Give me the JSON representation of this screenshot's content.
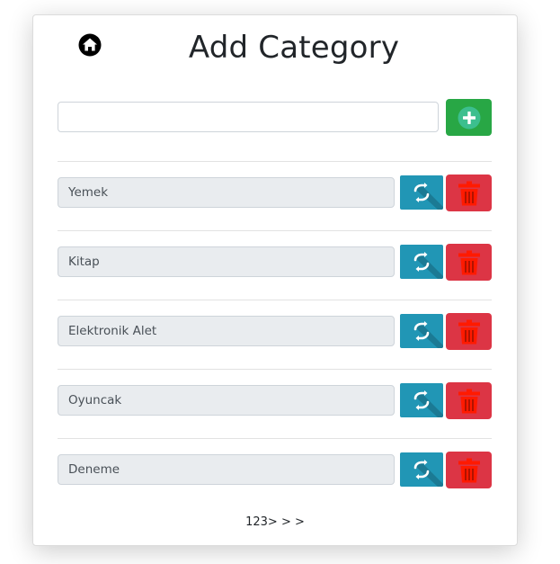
{
  "header": {
    "title": "Add Category",
    "home_icon": "home-icon"
  },
  "new_category": {
    "value": "",
    "placeholder": "",
    "add_icon": "plus-circle-icon",
    "add_color": "#28a745"
  },
  "categories": [
    {
      "name": "Yemek"
    },
    {
      "name": "Kitap"
    },
    {
      "name": "Elektronik Alet"
    },
    {
      "name": "Oyuncak"
    },
    {
      "name": "Deneme"
    }
  ],
  "row_actions": {
    "update_icon": "refresh-icon",
    "update_color": "#2196b5",
    "delete_icon": "trash-icon",
    "delete_color": "#dc3545"
  },
  "pagination": {
    "pages": [
      "1",
      "2",
      "3"
    ],
    "next": ">",
    "next_more": ">",
    "last": ">"
  }
}
